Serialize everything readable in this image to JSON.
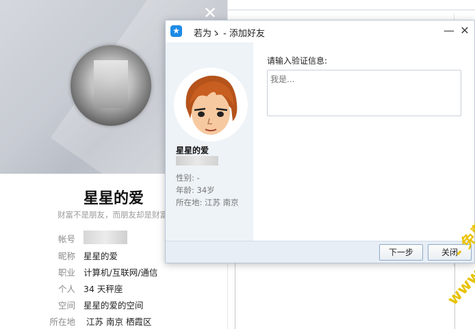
{
  "profile": {
    "name": "星星的爱",
    "motto": "财富不是朋友，而朋友却是财富",
    "rows": [
      {
        "key": "帐号",
        "value": ""
      },
      {
        "key": "昵称",
        "value": "星星的爱"
      },
      {
        "key": "职业",
        "value": "计算机/互联网/通信"
      },
      {
        "key": "个人",
        "value": "34  天秤座"
      },
      {
        "key": "空间",
        "value": "星星的爱的空间"
      },
      {
        "key": "所在地",
        "value": "江苏  南京  栖霞区"
      }
    ]
  },
  "dialog": {
    "title": "若为ゝ - 添加好友",
    "friend_name": "星星的爱",
    "gender": "性别:  -",
    "age": "年龄:  34岁",
    "location": "所在地:  江苏   南京",
    "verify_label": "请输入验证信息:",
    "verify_placeholder": "我是...",
    "next_button": "下一步",
    "close_button": "关闭"
  },
  "watermark": {
    "line1": "- 免费色色 -",
    "line2": "www.MFsese.com"
  },
  "colors": {
    "accent": "#1e8be6",
    "footer": "#e7eef6",
    "watermark": "#e9c200"
  }
}
